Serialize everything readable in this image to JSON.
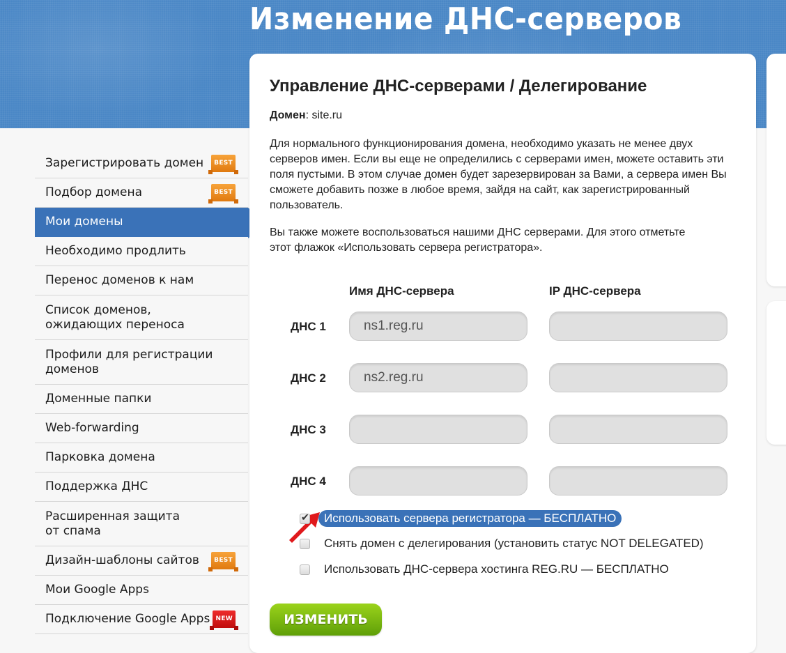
{
  "page": {
    "title": "Изменение ДНС-серверов"
  },
  "sidebar": {
    "items": [
      {
        "label": "Зарегистрировать домен",
        "badge": "BEST"
      },
      {
        "label": "Подбор домена",
        "badge": "BEST"
      },
      {
        "label": "Мои домены",
        "active": true
      },
      {
        "label": "Необходимо продлить"
      },
      {
        "label": "Перенос доменов к нам"
      },
      {
        "label": "Список доменов, ожидающих переноса"
      },
      {
        "label": "Профили для регистрации доменов"
      },
      {
        "label": "Доменные папки"
      },
      {
        "label": "Web-forwarding"
      },
      {
        "label": "Парковка домена"
      },
      {
        "label": "Поддержка ДНС"
      },
      {
        "label": "Расширенная защита от спама"
      },
      {
        "label": "Дизайн-шаблоны сайтов",
        "badge": "BEST"
      },
      {
        "label": "Мои Google Apps"
      },
      {
        "label": "Подключение Google Apps",
        "badge": "NEW"
      }
    ]
  },
  "card": {
    "title": "Управление ДНС-серверами / Делегирование",
    "domain_label": "Домен",
    "domain_value": ": site.ru",
    "paragraph1": "Для нормального функционирования домена, необходимо указать не менее двух серверов имен. Если вы еще не определились с серверами имен, можете оставить эти поля пустыми. В этом случае домен будет зарезервирован за Вами, а сервера имен Вы сможете добавить позже в любое время, зайдя на сайт, как зарегистрированный пользователь.",
    "paragraph2": "Вы также можете воспользоваться нашими ДНС серверами. Для этого отметьте этот флажок «Использовать сервера регистратора».",
    "col_name": "Имя ДНС-сервера",
    "col_ip": "IP ДНС-сервера",
    "dns_rows": [
      {
        "label": "ДНС 1",
        "name": "ns1.reg.ru",
        "ip": ""
      },
      {
        "label": "ДНС 2",
        "name": "ns2.reg.ru",
        "ip": ""
      },
      {
        "label": "ДНС 3",
        "name": "",
        "ip": ""
      },
      {
        "label": "ДНС 4",
        "name": "",
        "ip": ""
      }
    ],
    "checkboxes": [
      {
        "label": "Использовать сервера регистратора — БЕСПЛАТНО",
        "checked": true
      },
      {
        "label": "Снять домен с делегирования (установить статус NOT DELEGATED)",
        "checked": false
      },
      {
        "label": "Использовать ДНС-сервера хостинга REG.RU — БЕСПЛАТНО",
        "checked": false
      }
    ],
    "submit_label": "ИЗМЕНИТЬ"
  },
  "colors": {
    "header_blue": "#4a87c6",
    "active_blue": "#3a72b8",
    "button_green": "#7cbb12",
    "arrow_red": "#e0191c"
  }
}
